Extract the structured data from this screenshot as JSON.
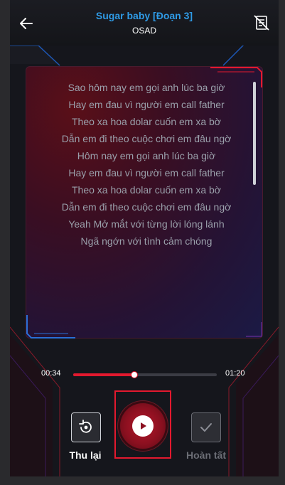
{
  "header": {
    "title": "Sugar baby [Đoạn 3]",
    "artist": "OSAD",
    "back_icon": "arrow-left-icon",
    "lyrics_off_icon": "lyrics-off-icon"
  },
  "lyrics": {
    "lines": [
      "Sao hôm nay em gọi anh lúc ba giờ",
      "Hay em đau vì người em call father",
      "Theo xa hoa dolar cuốn em xa bờ",
      "Dẫn em đi theo cuộc chơi em đâu ngờ",
      "Hôm nay em gọi anh lúc ba giờ",
      "Hay em đau vì người em call father",
      "Theo xa hoa dolar cuốn em xa bờ",
      "Dẫn em đi theo cuộc chơi em đâu ngờ",
      "Yeah Mở mắt với từng lời lóng lánh",
      "Ngã ngớn với tình cảm chóng"
    ]
  },
  "player": {
    "current_time": "00:34",
    "total_time": "01:20",
    "progress": 0.425
  },
  "controls": {
    "retry_label": "Thu lại",
    "retry_icon": "retry-icon",
    "play_icon": "play-icon",
    "done_label": "Hoàn tất",
    "done_icon": "check-icon"
  },
  "colors": {
    "accent": "#e3192e",
    "title": "#2f9be6",
    "disabled": "#6c6e76"
  }
}
